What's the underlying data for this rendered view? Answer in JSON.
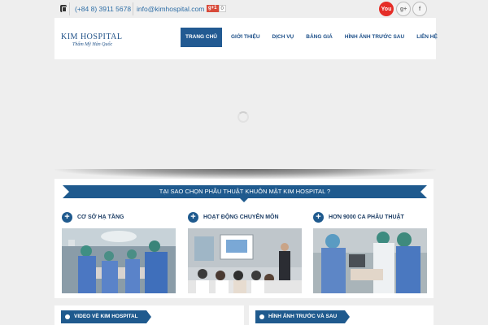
{
  "topbar": {
    "phone": "(+84 8) 3911 5678",
    "email": "info@kimhospital.com",
    "gplus_label": "g+1",
    "gplus_count": "0",
    "social": {
      "youtube": "You",
      "googleplus": "g+",
      "facebook": "f"
    }
  },
  "header": {
    "logo_main": "KIM HOSPITAL",
    "logo_sub": "Thẩm Mỹ Hàn Quốc",
    "nav": [
      "TRANG CHỦ",
      "GIỚI THIỆU",
      "DỊCH VỤ",
      "BẢNG GIÁ",
      "HÌNH ẢNH TRƯỚC SAU",
      "LIÊN HỆ"
    ],
    "active_nav": "TRANG CHỦ"
  },
  "section": {
    "title": "TẠI SAO CHỌN PHẪU THUẬT KHUÔN MẶT KIM HOSPITAL ?",
    "features": [
      {
        "title": "CƠ SỞ HẠ TẦNG"
      },
      {
        "title": "HOẠT ĐỘNG CHUYÊN MÔN"
      },
      {
        "title": "HƠN 9000 CA PHẪU THUẬT"
      }
    ]
  },
  "bottom": {
    "video_title": "VIDEO VỀ KIM HOSPITAL",
    "gallery_title": "HÌNH ẢNH TRƯỚC VÀ SAU"
  },
  "colors": {
    "primary": "#1f5a8e",
    "nav_active": "#225a92",
    "youtube": "#e52d27"
  }
}
